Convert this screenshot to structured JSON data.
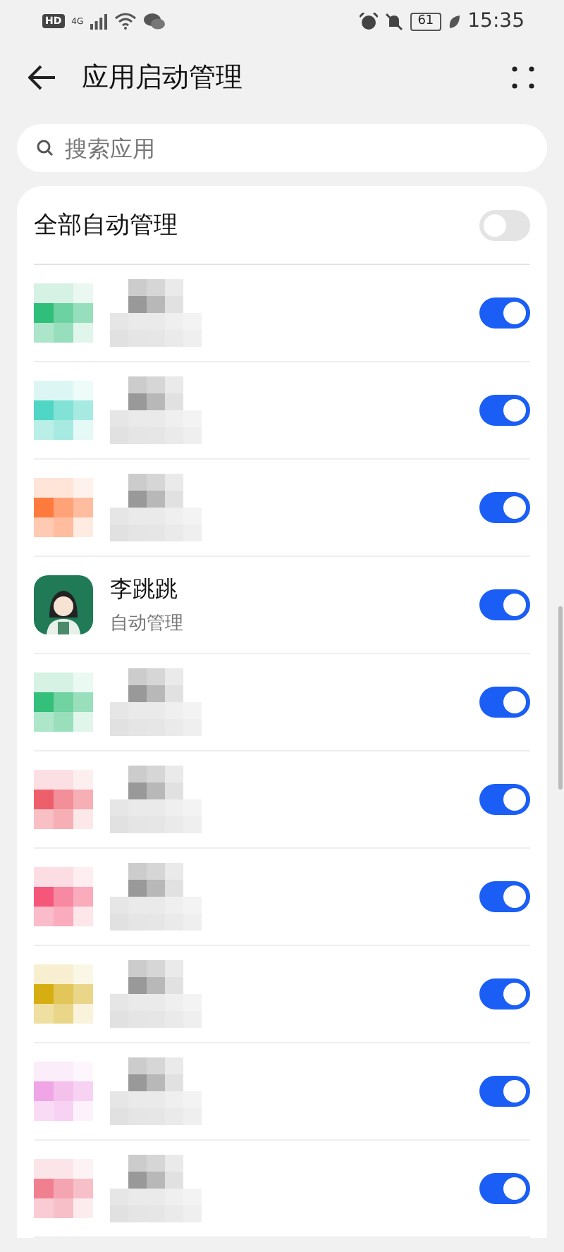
{
  "status_bar": {
    "hd": "HD",
    "network": "4G",
    "battery": "61",
    "time": "15:35"
  },
  "header": {
    "title": "应用启动管理"
  },
  "search": {
    "placeholder": "搜索应用"
  },
  "all_auto": {
    "label": "全部自动管理",
    "on": false
  },
  "apps": [
    {
      "kind": "masked",
      "color": "#2fbf7a",
      "on": true
    },
    {
      "kind": "masked",
      "color": "#4fd6c4",
      "on": true
    },
    {
      "kind": "masked",
      "color": "#ff7a3d",
      "on": true
    },
    {
      "kind": "app",
      "name": "李跳跳",
      "subtitle": "自动管理",
      "on": true
    },
    {
      "kind": "masked",
      "color": "#34c07a",
      "on": true
    },
    {
      "kind": "masked",
      "color": "#ee5f6c",
      "on": true
    },
    {
      "kind": "masked",
      "color": "#f5577a",
      "on": true
    },
    {
      "kind": "masked",
      "color": "#d6ae12",
      "on": true
    },
    {
      "kind": "masked",
      "color": "#f0a6e6",
      "on": true
    },
    {
      "kind": "masked",
      "color": "#f07f90",
      "on": true
    }
  ]
}
